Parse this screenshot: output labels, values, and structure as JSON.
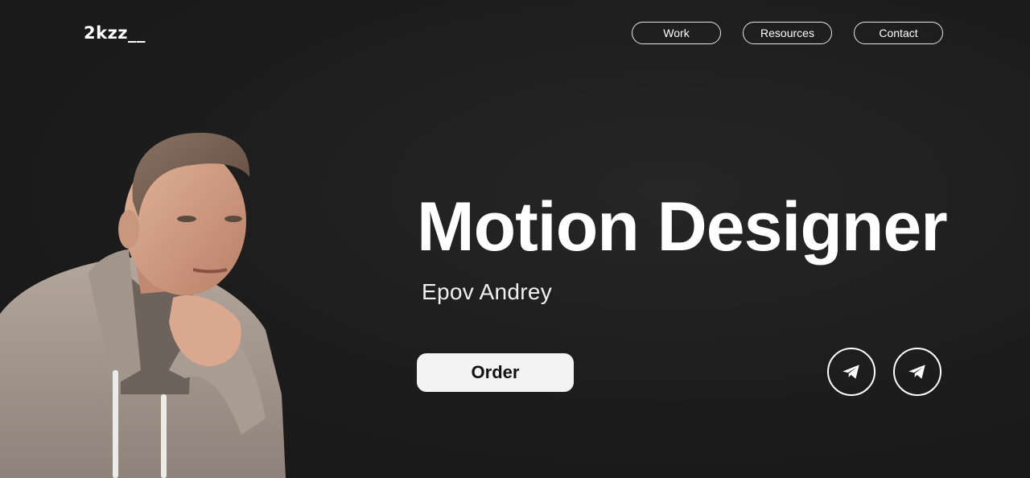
{
  "header": {
    "logo": "2kzz__",
    "nav": [
      {
        "label": "Work"
      },
      {
        "label": "Resources"
      },
      {
        "label": "Contact"
      }
    ]
  },
  "hero": {
    "title": "Motion Designer",
    "name": "Epov Andrey",
    "cta_label": "Order"
  },
  "social": [
    {
      "icon": "telegram-icon"
    },
    {
      "icon": "telegram-icon"
    }
  ],
  "colors": {
    "background": "#1c1c1c",
    "text": "#ffffff",
    "cta_bg": "#f3f3f3",
    "cta_text": "#111111"
  }
}
